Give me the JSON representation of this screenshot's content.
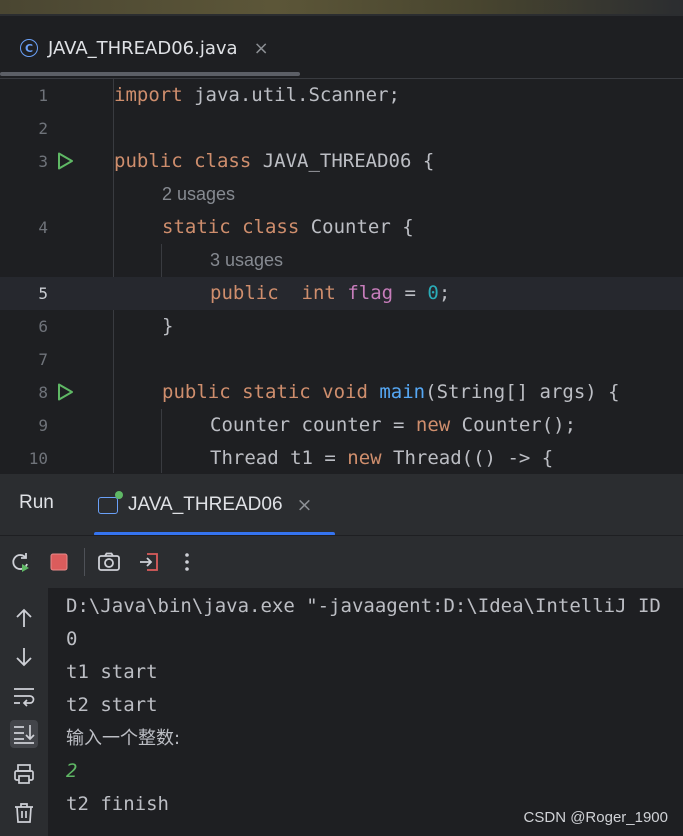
{
  "editor_tab": {
    "label": "JAVA_THREAD06.java",
    "icon": "java-class-icon",
    "close": "×"
  },
  "code_lines": [
    {
      "n": "1",
      "text": "import java.util.Scanner;"
    },
    {
      "n": "2",
      "text": ""
    },
    {
      "n": "3",
      "text": "public class JAVA_THREAD06 {"
    },
    {
      "n": "4",
      "text": "static class Counter {"
    },
    {
      "n": "5",
      "text": "public  int flag = 0;"
    },
    {
      "n": "6",
      "text": "}"
    },
    {
      "n": "7",
      "text": ""
    },
    {
      "n": "8",
      "text": "public static void main(String[] args) {"
    },
    {
      "n": "9",
      "text": "Counter counter = new Counter();"
    },
    {
      "n": "10",
      "text": "Thread t1 = new Thread(() -> {"
    }
  ],
  "inlay_hints": {
    "counter_usages": "2 usages",
    "flag_usages": "3 usages"
  },
  "run_panel": {
    "title": "Run",
    "tab_label": "JAVA_THREAD06",
    "tab_close": "×"
  },
  "toolbar": [
    "rerun-icon",
    "stop-icon",
    "screenshot-icon",
    "exit-icon",
    "more-options-icon"
  ],
  "sidebar": [
    "scroll-up-icon",
    "scroll-down-icon",
    "soft-wrap-icon",
    "scroll-to-end-icon",
    "print-icon",
    "clear-icon"
  ],
  "console_lines": [
    "D:\\Java\\bin\\java.exe \"-javaagent:D:\\Idea\\IntelliJ ID",
    "0",
    "t1 start",
    "t2 start",
    "输入一个整数:",
    "2",
    "t2 finish"
  ],
  "watermark": "CSDN @Roger_1900",
  "colors": {
    "accent": "#3574f0",
    "run_green": "#5fb865",
    "stop_red": "#db5c5c"
  }
}
